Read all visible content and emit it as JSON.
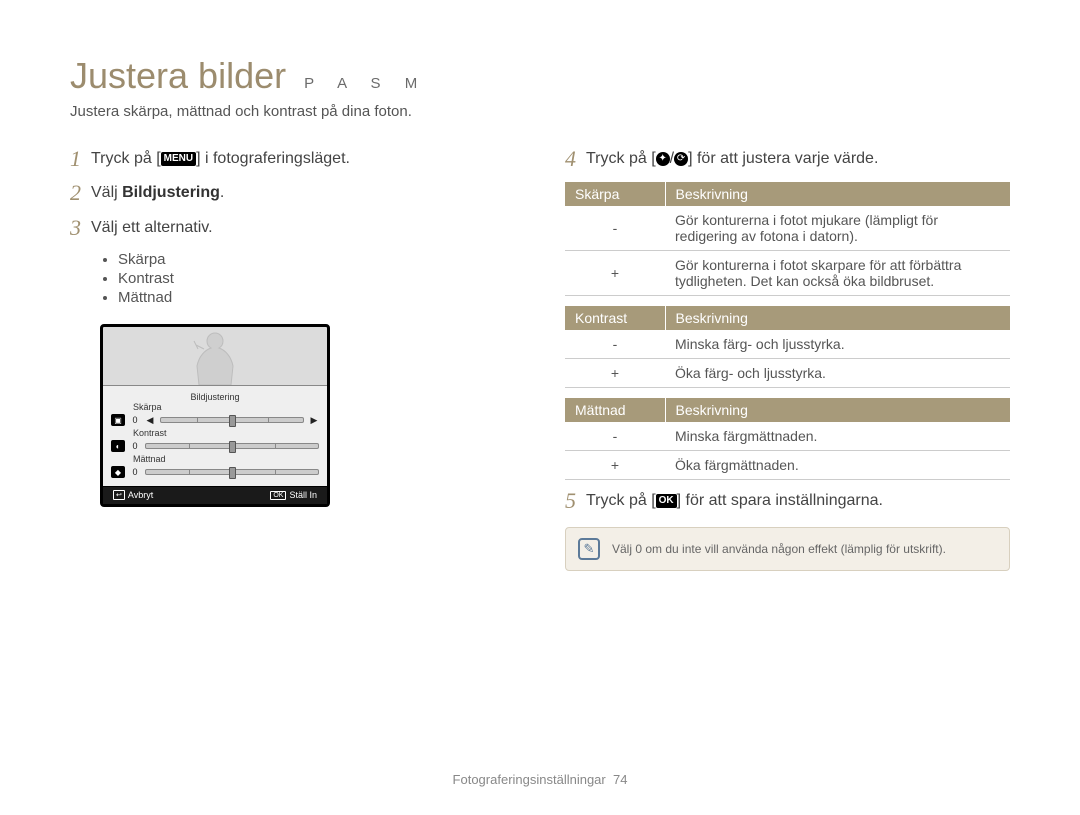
{
  "title": "Justera bilder",
  "pasm": "P A S M",
  "subtitle": "Justera skärpa, mättnad och kontrast på dina foton.",
  "left": {
    "step1_pre": "Tryck på [",
    "step1_icon": "MENU",
    "step1_post": "] i fotograferingsläget.",
    "step2_pre": "Välj ",
    "step2_bold": "Bildjustering",
    "step2_post": ".",
    "step3": "Välj ett alternativ.",
    "bullets": [
      "Skärpa",
      "Kontrast",
      "Mättnad"
    ],
    "screen": {
      "title": "Bildjustering",
      "rows": [
        "Skärpa",
        "Kontrast",
        "Mättnad"
      ],
      "value": "0",
      "cancel": "Avbryt",
      "ok": "Ställ In",
      "back_icon": "↩",
      "ok_icon": "OK"
    }
  },
  "right": {
    "step4_pre": "Tryck på [",
    "step4_icon1": "✦",
    "step4_sep": "/",
    "step4_icon2": "⟳",
    "step4_post": "] för att justera varje värde.",
    "tables": [
      {
        "head": [
          "Skärpa",
          "Beskrivning"
        ],
        "rows": [
          [
            "-",
            "Gör konturerna i fotot mjukare (lämpligt för redigering av fotona i datorn)."
          ],
          [
            "+",
            "Gör konturerna i fotot skarpare för att förbättra tydligheten. Det kan också öka bildbruset."
          ]
        ]
      },
      {
        "head": [
          "Kontrast",
          "Beskrivning"
        ],
        "rows": [
          [
            "-",
            "Minska färg- och ljusstyrka."
          ],
          [
            "+",
            "Öka färg- och ljusstyrka."
          ]
        ]
      },
      {
        "head": [
          "Mättnad",
          "Beskrivning"
        ],
        "rows": [
          [
            "-",
            "Minska färgmättnaden."
          ],
          [
            "+",
            "Öka färgmättnaden."
          ]
        ]
      }
    ],
    "step5_pre": "Tryck på [",
    "step5_icon": "OK",
    "step5_post": "] för att spara inställningarna.",
    "note_icon": "✎",
    "note": "Välj 0 om du inte vill använda någon effekt (lämplig för utskrift)."
  },
  "footer_label": "Fotograferingsinställningar",
  "footer_page": "74"
}
